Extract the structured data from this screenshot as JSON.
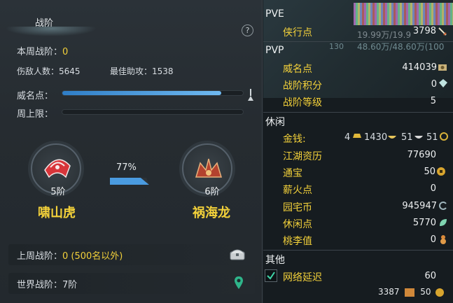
{
  "left": {
    "tab_title": "战阶",
    "help_label": "?",
    "weekly_rank_label": "本周战阶：",
    "weekly_rank_value": "0",
    "kills_label": "伤敌人数：",
    "kills_value": "5645",
    "best_assist_label": "最佳助攻：",
    "best_assist_value": "1538",
    "prestige_label": "威名点：",
    "prestige_progress": 0.88,
    "weekly_cap_label": "周上限：",
    "weekly_cap_progress": 0,
    "current_tier": "5阶",
    "current_rank_name": "啸山虎",
    "next_tier": "6阶",
    "next_rank_name": "祸海龙",
    "progress_pct": "77%",
    "last_week_label": "上周战阶：",
    "last_week_value": "0 (500名以外)",
    "world_rank_label": "世界战阶：",
    "world_rank_value": "7阶"
  },
  "right": {
    "pve_head": "PVE",
    "pve_items": [
      {
        "name": "侠行点",
        "value": "3798"
      }
    ],
    "bg_texts": [
      "19.99万/19.9",
      "48.60万/48.60万(100",
      "130"
    ],
    "pvp_head": "PVP",
    "pvp_items": [
      {
        "name": "威名点",
        "value": "414039"
      },
      {
        "name": "战阶积分",
        "value": "0"
      },
      {
        "name": "战阶等级",
        "value": "5"
      }
    ],
    "leisure_head": "休闲",
    "money_label": "金钱:",
    "money_gold": "4",
    "money_silver": "1430",
    "money_copper": "51",
    "money_other": "51",
    "leisure_items": [
      {
        "name": "江湖资历",
        "value": "77690"
      },
      {
        "name": "通宝",
        "value": "50"
      },
      {
        "name": "薪火点",
        "value": "0"
      },
      {
        "name": "园宅币",
        "value": "945947"
      },
      {
        "name": "休闲点",
        "value": "5770"
      },
      {
        "name": "桃李值",
        "value": "0"
      }
    ],
    "other_head": "其他",
    "latency_label": "网络延迟",
    "latency_value": "60",
    "bottom_value1": "3387",
    "bottom_value2": "50"
  },
  "colors": {
    "accent_yellow": "#f3d13a",
    "bar_blue": "#4a9be0",
    "panel_bg": "#262c31"
  },
  "icons": [
    "question-icon",
    "marker-icon",
    "fan-emblem-icon",
    "crown-emblem-icon",
    "arrow-icon",
    "chest-icon",
    "location-icon",
    "sword-icon",
    "coin-icon",
    "gem-icon",
    "gold-ingot-icon",
    "silver-ingot-icon",
    "copper-icon",
    "tongbao-icon",
    "house-coin-icon",
    "leaf-icon",
    "gourd-icon",
    "checkbox-icon"
  ]
}
